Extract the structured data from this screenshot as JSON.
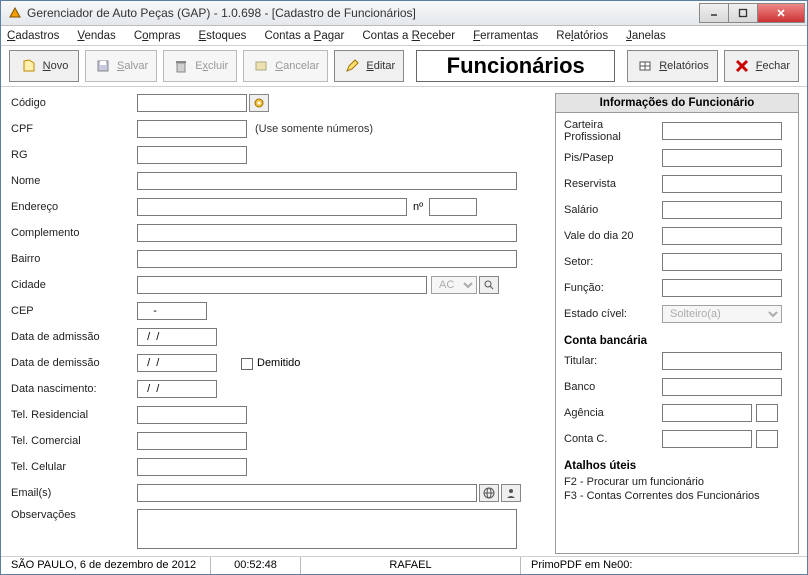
{
  "window": {
    "title": "Gerenciador de Auto Peças (GAP) - 1.0.698 - [Cadastro de Funcionários]"
  },
  "menu": {
    "cadastros": "Cadastros",
    "vendas": "Vendas",
    "compras": "Compras",
    "estoques": "Estoques",
    "contas_pagar": "Contas a Pagar",
    "contas_receber": "Contas a Receber",
    "ferramentas": "Ferramentas",
    "relatorios": "Relatórios",
    "janelas": "Janelas"
  },
  "toolbar": {
    "novo": "Novo",
    "salvar": "Salvar",
    "excluir": "Excluir",
    "cancelar": "Cancelar",
    "editar": "Editar",
    "title": "Funcionários",
    "relatorios": "Relatórios",
    "fechar": "Fechar"
  },
  "form": {
    "codigo_label": "Código",
    "codigo_value": "",
    "cpf_label": "CPF",
    "cpf_value": "",
    "cpf_hint": "(Use somente números)",
    "rg_label": "RG",
    "rg_value": "",
    "nome_label": "Nome",
    "nome_value": "",
    "endereco_label": "Endereço",
    "endereco_value": "",
    "numero_label": "nº",
    "numero_value": "",
    "complemento_label": "Complemento",
    "complemento_value": "",
    "bairro_label": "Bairro",
    "bairro_value": "",
    "cidade_label": "Cidade",
    "cidade_value": "",
    "uf_value": "AC",
    "cep_label": "CEP",
    "cep_value": "    -",
    "admissao_label": "Data de admissão",
    "admissao_value": "  /  /",
    "demissao_label": "Data de demissão",
    "demissao_value": "  /  /",
    "demitido_label": "Demitido",
    "nascimento_label": "Data nascimento:",
    "nascimento_value": "  /  /",
    "tel_res_label": "Tel. Residencial",
    "tel_res_value": "",
    "tel_com_label": "Tel. Comercial",
    "tel_com_value": "",
    "tel_cel_label": "Tel. Celular",
    "tel_cel_value": "",
    "emails_label": "Email(s)",
    "emails_value": "",
    "obs_label": "Observações",
    "obs_value": ""
  },
  "info": {
    "header": "Informações do Funcionário",
    "carteira_label": "Carteira Profissional",
    "carteira_value": "",
    "pis_label": "Pis/Pasep",
    "pis_value": "",
    "reservista_label": "Reservista",
    "reservista_value": "",
    "salario_label": "Salário",
    "salario_value": "",
    "vale_label": "Vale do dia 20",
    "vale_value": "",
    "setor_label": "Setor:",
    "setor_value": "",
    "funcao_label": "Função:",
    "funcao_value": "",
    "estado_civil_label": "Estado cível:",
    "estado_civil_value": "Solteiro(a)",
    "bank_header": "Conta bancária",
    "titular_label": "Titular:",
    "titular_value": "",
    "banco_label": "Banco",
    "banco_value": "",
    "agencia_label": "Agência",
    "agencia_value": "",
    "agencia_digit": "",
    "conta_label": "Conta C.",
    "conta_value": "",
    "conta_digit": "",
    "shortcuts_header": "Atalhos úteis",
    "shortcut1": "F2 - Procurar um funcionário",
    "shortcut2": "F3 - Contas Correntes dos Funcionários"
  },
  "status": {
    "location_date": "SÃO PAULO, 6 de dezembro de 2012",
    "time": "00:52:48",
    "user": "RAFAEL",
    "printer": "PrimoPDF em Ne00:"
  }
}
